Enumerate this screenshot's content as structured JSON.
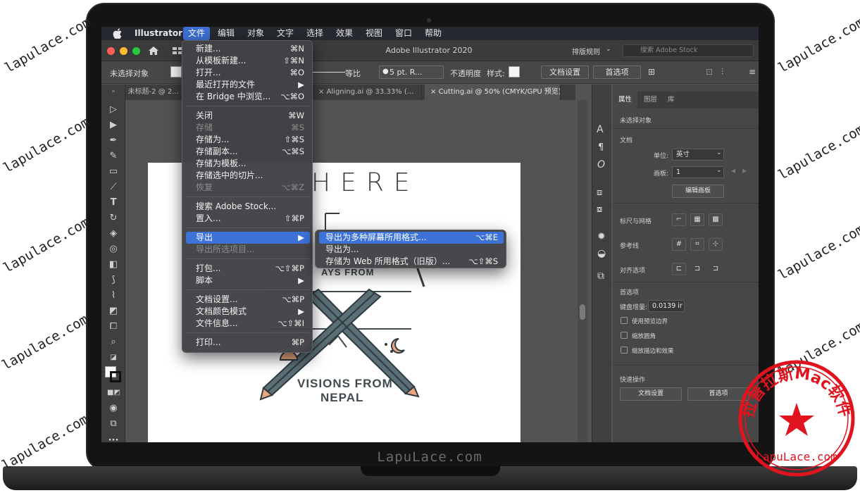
{
  "menubar": {
    "app_name": "Illustrator",
    "items": [
      "文件",
      "编辑",
      "对象",
      "文字",
      "选择",
      "效果",
      "视图",
      "窗口",
      "帮助"
    ]
  },
  "titlebar": {
    "window_title": "Adobe Illustrator 2020",
    "arrange_label": "排版规则",
    "search_placeholder": "搜索 Adobe Stock"
  },
  "controlbar": {
    "selection_label": "未选择对象",
    "stroke_profile": "等比",
    "brush_value": "5 pt. R...",
    "opacity_label": "不透明度",
    "style_label": "样式:",
    "doc_settings_button": "文档设置",
    "preferences_button": "首选项"
  },
  "tabs": [
    {
      "label": "未标题-2 @ 2..."
    },
    {
      "label": "Aligning.ai @ 33.33% (..."
    },
    {
      "label": "Cutting.ai @ 50% (CMYK/GPU 预览)"
    }
  ],
  "artboard": {
    "headline": "HERE",
    "fragment_text": "AYS FROM",
    "title_line1": "VISIONS FROM",
    "title_line2": "NEPAL"
  },
  "file_menu": {
    "items": [
      {
        "label": "新建...",
        "shortcut": "⌘N",
        "disabled": false
      },
      {
        "label": "从模板新建...",
        "shortcut": "⇧⌘N",
        "disabled": false
      },
      {
        "label": "打开...",
        "shortcut": "⌘O",
        "disabled": false
      },
      {
        "label": "最近打开的文件",
        "shortcut": "▶",
        "disabled": false
      },
      {
        "label": "在 Bridge 中浏览...",
        "shortcut": "⌥⌘O",
        "disabled": false
      },
      {
        "label": "关闭",
        "shortcut": "⌘W",
        "disabled": false
      },
      {
        "label": "存储",
        "shortcut": "⌘S",
        "disabled": true
      },
      {
        "label": "存储为...",
        "shortcut": "⇧⌘S",
        "disabled": false
      },
      {
        "label": "存储副本...",
        "shortcut": "⌥⌘S",
        "disabled": false
      },
      {
        "label": "存储为模板...",
        "shortcut": "",
        "disabled": false
      },
      {
        "label": "存储选中的切片...",
        "shortcut": "",
        "disabled": false
      },
      {
        "label": "恢复",
        "shortcut": "⌥⌘Z",
        "disabled": true
      },
      {
        "label": "搜索 Adobe Stock...",
        "shortcut": "",
        "disabled": false
      },
      {
        "label": "置入...",
        "shortcut": "⇧⌘P",
        "disabled": false
      },
      {
        "label": "导出",
        "shortcut": "▶",
        "disabled": false
      },
      {
        "label": "导出所选项目...",
        "shortcut": "",
        "disabled": true
      },
      {
        "label": "打包...",
        "shortcut": "⌥⇧⌘P",
        "disabled": false
      },
      {
        "label": "脚本",
        "shortcut": "▶",
        "disabled": false
      },
      {
        "label": "文档设置...",
        "shortcut": "⌥⌘P",
        "disabled": false
      },
      {
        "label": "文档颜色模式",
        "shortcut": "▶",
        "disabled": false
      },
      {
        "label": "文件信息...",
        "shortcut": "⌥⇧⌘I",
        "disabled": false
      },
      {
        "label": "打印...",
        "shortcut": "⌘P",
        "disabled": false
      }
    ]
  },
  "export_submenu": {
    "items": [
      {
        "label": "导出为多种屏幕所用格式...",
        "shortcut": "⌥⌘E"
      },
      {
        "label": "导出为...",
        "shortcut": ""
      },
      {
        "label": "存储为 Web 所用格式（旧版）...",
        "shortcut": "⌥⇧⌘S"
      }
    ]
  },
  "properties": {
    "tabs": [
      "属性",
      "图层",
      "库"
    ],
    "no_selection": "未选择对象",
    "document_section": "文档",
    "units_label": "单位:",
    "units_value": "英寸",
    "artboard_label": "画板:",
    "artboard_value": "1",
    "edit_artboards_button": "编辑画板",
    "rulers_grids_label": "标尺与网格",
    "guides_label": "参考线",
    "align_options_label": "对齐选项",
    "preferences_section": "首选项",
    "keyboard_increment_label": "键盘增量:",
    "keyboard_increment_value": "0.0139 ir",
    "checkboxes": [
      "使用预览边界",
      "缩放圆角",
      "缩放描边和效果"
    ],
    "quick_actions_label": "快速操作",
    "doc_settings_button": "文档设置",
    "preferences_button": "首选项"
  },
  "branding": {
    "bezel_text": "LapuLace.com",
    "watermark_text": "lapulace.com",
    "seal_text": "拉普拉斯Mac软件",
    "seal_url": "LapuLace.com"
  },
  "colors": {
    "menu_highlight": "#3d72d8",
    "seal_red": "#e0141e",
    "art_teal": "#5b6f77",
    "art_salmon": "#e7a782"
  }
}
